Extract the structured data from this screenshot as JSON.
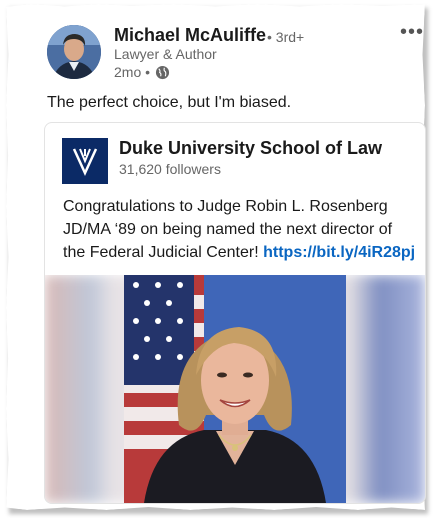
{
  "post": {
    "author_name": "Michael McAuliffe",
    "connection_degree": "• 3rd+",
    "headline": "Lawyer & Author",
    "time_ago": "2mo •",
    "text": "The perfect choice, but I'm biased."
  },
  "shared": {
    "org_name": "Duke University School of Law",
    "followers": "31,620 followers",
    "body": "Congratulations to Judge Robin L. Rosenberg JD/MA ‘89 on being named the next director of the Federal Judicial Center!",
    "link": "https://bit.ly/4iR28pj"
  },
  "icons": {
    "menu": "more-options-icon",
    "visibility": "globe-icon"
  },
  "colors": {
    "link": "#0a66c2",
    "logo_bg": "#0b2a66"
  }
}
